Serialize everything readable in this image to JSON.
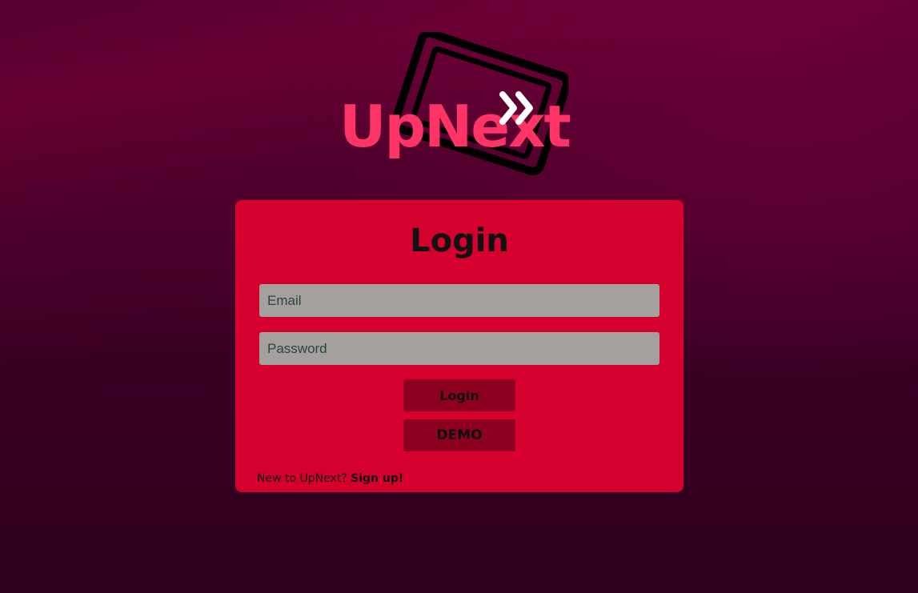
{
  "brand": {
    "name": "UpNext",
    "name_part1": "UpNe",
    "name_part2": "t",
    "color": "#ff3466"
  },
  "login_card": {
    "title": "Login",
    "email_placeholder": "Email",
    "password_placeholder": "Password",
    "login_button": "Login",
    "demo_button": "DEMO",
    "signup_prompt": "New to UpNext?",
    "signup_link": "Sign up!"
  },
  "colors": {
    "card_background": "#d6002f",
    "button_background": "#8e0020",
    "input_background": "#a3a09e",
    "page_background": "#3a0024"
  }
}
